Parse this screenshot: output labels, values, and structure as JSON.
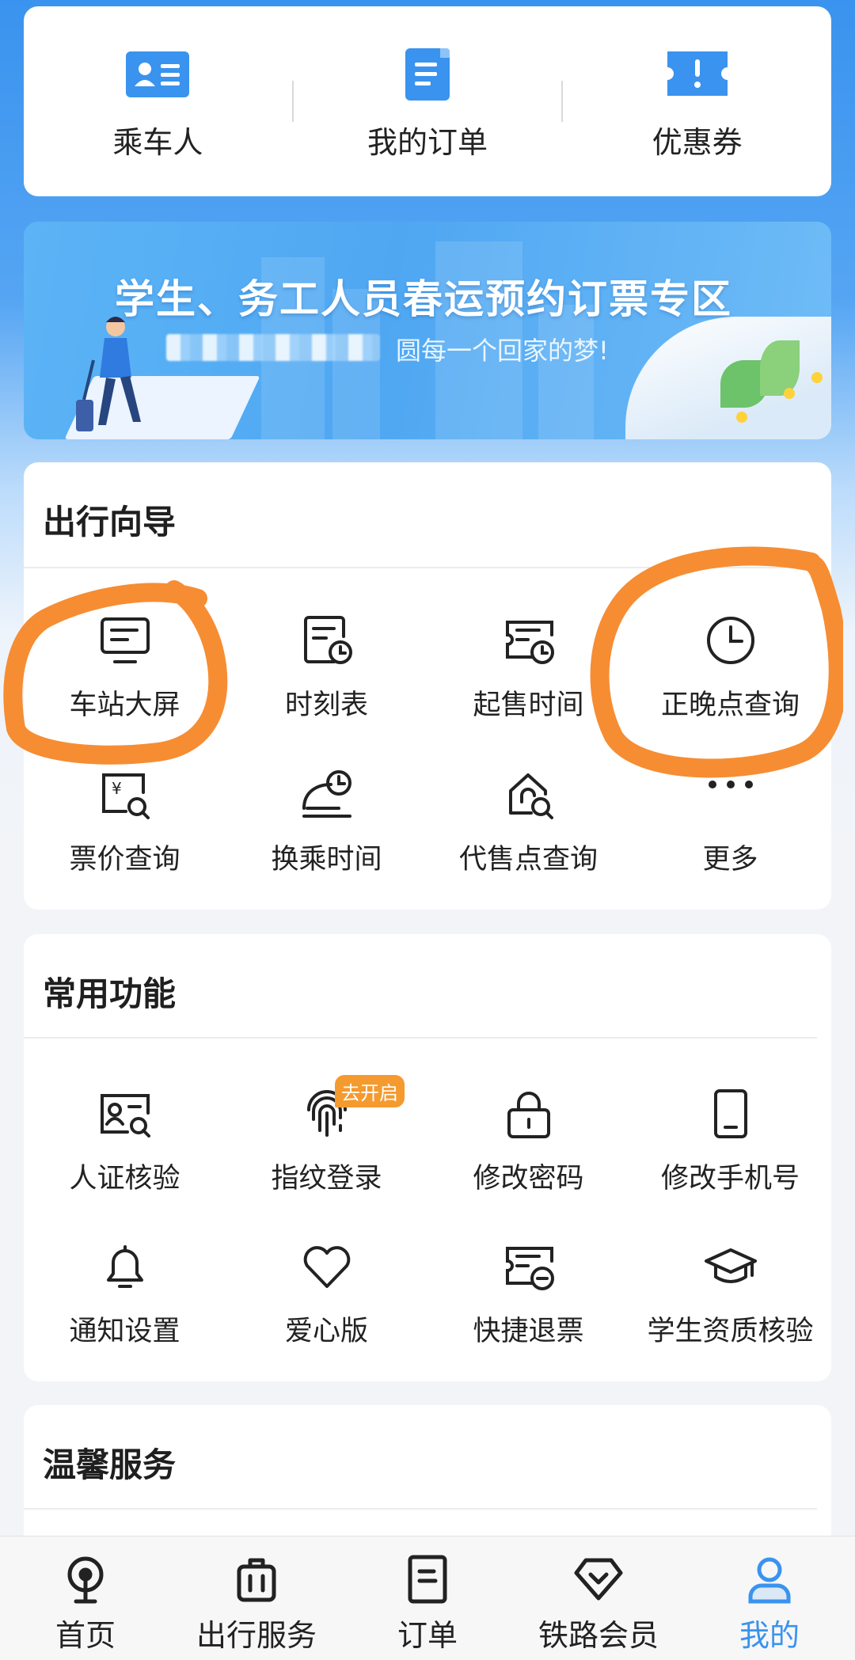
{
  "quick_actions": [
    {
      "label": "乘车人",
      "icon": "passenger-card-icon"
    },
    {
      "label": "我的订单",
      "icon": "order-document-icon"
    },
    {
      "label": "优惠券",
      "icon": "coupon-ticket-icon"
    }
  ],
  "banner": {
    "title": "学生、务工人员春运预约订票专区",
    "subtitle": "圆每一个回家的梦!"
  },
  "travel_guide": {
    "title": "出行向导",
    "items": [
      {
        "label": "车站大屏",
        "icon": "station-screen-icon"
      },
      {
        "label": "时刻表",
        "icon": "timetable-icon"
      },
      {
        "label": "起售时间",
        "icon": "sale-time-icon"
      },
      {
        "label": "正晚点查询",
        "icon": "clock-icon"
      },
      {
        "label": "票价查询",
        "icon": "fare-search-icon"
      },
      {
        "label": "换乘时间",
        "icon": "transfer-time-icon"
      },
      {
        "label": "代售点查询",
        "icon": "agency-search-icon"
      },
      {
        "label": "更多",
        "icon": "more-dots-icon"
      }
    ]
  },
  "common_functions": {
    "title": "常用功能",
    "badge": "去开启",
    "items": [
      {
        "label": "人证核验",
        "icon": "id-verify-icon"
      },
      {
        "label": "指纹登录",
        "icon": "fingerprint-icon"
      },
      {
        "label": "修改密码",
        "icon": "lock-icon"
      },
      {
        "label": "修改手机号",
        "icon": "phone-icon"
      },
      {
        "label": "通知设置",
        "icon": "bell-icon"
      },
      {
        "label": "爱心版",
        "icon": "heart-icon"
      },
      {
        "label": "快捷退票",
        "icon": "refund-ticket-icon"
      },
      {
        "label": "学生资质核验",
        "icon": "graduation-cap-icon"
      }
    ]
  },
  "warm_service": {
    "title": "温馨服务"
  },
  "bottom_nav": [
    {
      "label": "首页",
      "icon": "train-home-icon"
    },
    {
      "label": "出行服务",
      "icon": "luggage-icon"
    },
    {
      "label": "订单",
      "icon": "order-icon"
    },
    {
      "label": "铁路会员",
      "icon": "diamond-icon"
    },
    {
      "label": "我的",
      "icon": "user-icon",
      "active": true
    }
  ],
  "colors": {
    "accent": "#3a93ee",
    "annotation": "#f68d33",
    "badge": "#f59a2f"
  }
}
